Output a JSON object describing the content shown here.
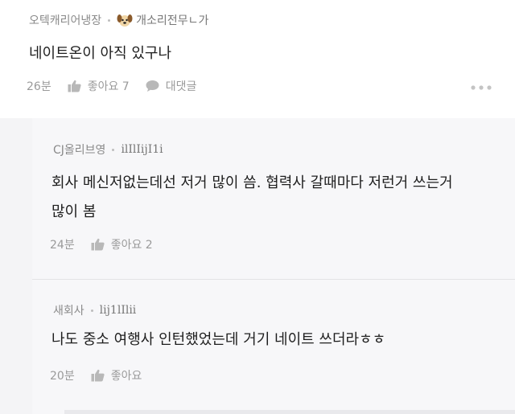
{
  "post": {
    "board": "오텍캐리어냉장",
    "nickname": "개소리전무ㄴ가",
    "content": "네이트온이 아직 있구나",
    "time": "26분",
    "like_label": "좋아요 7",
    "reply_label": "대댓글"
  },
  "replies": [
    {
      "board": "CJ올리브영",
      "nickname": "ilIlIijI1i",
      "content_lines": [
        "회사 메신저없는데선 저거 많이 씀. 협력사 갈때마다 저런거 쓰는거",
        "많이 봄"
      ],
      "time": "24분",
      "like_label": "좋아요 2"
    },
    {
      "board": "새회사",
      "nickname": "lij1lIlii",
      "content_lines": [
        "나도 중소 여행사 인턴했었는데 거기 네이트 쓰더라ㅎㅎ"
      ],
      "time": "20분",
      "like_label": "좋아요"
    }
  ],
  "icons": {
    "avatar": "dog-face-icon",
    "like": "thumbs-up-icon",
    "reply": "speech-bubble-icon",
    "more": "more-dots-icon"
  },
  "colors": {
    "reply_background": "#f4f4f6",
    "meta_text": "#8a8a8a",
    "icon_gray": "#b8b8b8"
  }
}
